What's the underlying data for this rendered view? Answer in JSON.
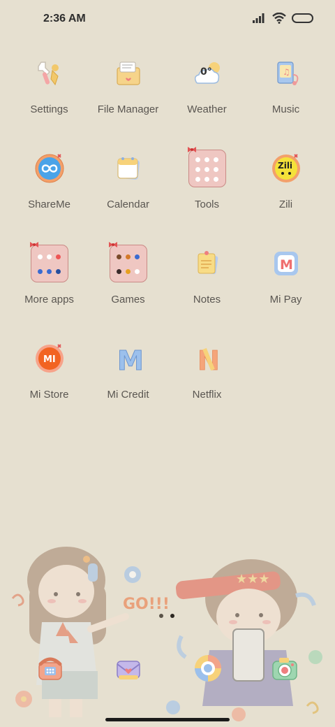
{
  "status_bar": {
    "time": "2:36 AM",
    "icons": [
      "signal-icon",
      "wifi-icon",
      "battery-icon"
    ]
  },
  "apps": [
    {
      "label": "Settings",
      "icon": "wrench-icon"
    },
    {
      "label": "File Manager",
      "icon": "folder-box-icon"
    },
    {
      "label": "Weather",
      "icon": "weather-cloud-icon",
      "icon_text": "0°"
    },
    {
      "label": "Music",
      "icon": "music-player-icon"
    },
    {
      "label": "ShareMe",
      "icon": "infinity-icon"
    },
    {
      "label": "Calendar",
      "icon": "calendar-icon"
    },
    {
      "label": "Tools",
      "icon": "folder-icon"
    },
    {
      "label": "Zili",
      "icon": "zili-icon",
      "icon_text": "Zili"
    },
    {
      "label": "More apps",
      "icon": "folder-icon"
    },
    {
      "label": "Games",
      "icon": "folder-icon"
    },
    {
      "label": "Notes",
      "icon": "notes-icon"
    },
    {
      "label": "Mi Pay",
      "icon": "mi-pay-icon",
      "icon_text": "M"
    },
    {
      "label": "Mi Store",
      "icon": "mi-store-icon",
      "icon_text": "MI"
    },
    {
      "label": "Mi Credit",
      "icon": "mi-credit-icon",
      "icon_text": "M"
    },
    {
      "label": "Netflix",
      "icon": "netflix-icon",
      "icon_text": "N"
    }
  ],
  "wallpaper": {
    "text": "GO!!!"
  },
  "dock": [
    {
      "icon": "phone-icon"
    },
    {
      "icon": "messages-icon"
    },
    {
      "icon": "browser-icon"
    },
    {
      "icon": "camera-icon"
    }
  ],
  "page_indicator": {
    "pages": 2,
    "current": 2
  },
  "colors": {
    "background": "#e6e0d0",
    "label": "#5a5651",
    "folder": "#efc7c2"
  }
}
